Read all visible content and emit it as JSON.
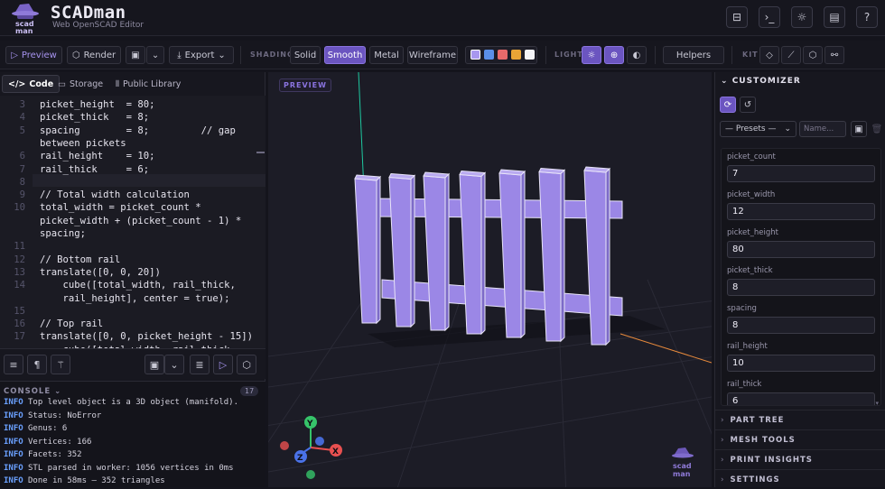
{
  "app": {
    "brand": "SCADman",
    "subtitle": "Web OpenSCAD Editor",
    "logo_text": "scad man"
  },
  "header_icons": [
    "panel-icon",
    "terminal-icon",
    "sun-icon",
    "book-icon",
    "help-icon"
  ],
  "toolbar": {
    "preview": "Preview",
    "render": "Render",
    "export": "Export",
    "shading_label": "SHADING",
    "shading": [
      "Solid",
      "Smooth",
      "Metal",
      "Wireframe"
    ],
    "shading_active": "Smooth",
    "swatches": [
      "#a897ee",
      "#5a8fe8",
      "#e86a6a",
      "#e8a436",
      "#f4f4f8"
    ],
    "light_label": "LIGHT",
    "helpers": "Helpers",
    "kit_label": "KIT"
  },
  "left_tabs": {
    "code": "Code",
    "storage": "Storage",
    "library": "Public Library"
  },
  "code_lines": [
    {
      "n": "3",
      "t": "picket_height  = 80;"
    },
    {
      "n": "4",
      "t": "picket_thick   = 8;"
    },
    {
      "n": "5",
      "t": "spacing        = 8;         // gap"
    },
    {
      "n": "",
      "t": "between pickets"
    },
    {
      "n": "6",
      "t": "rail_height    = 10;"
    },
    {
      "n": "7",
      "t": "rail_thick     = 6;"
    },
    {
      "n": "8",
      "t": ""
    },
    {
      "n": "9",
      "t": "// Total width calculation"
    },
    {
      "n": "10",
      "t": "total_width = picket_count *"
    },
    {
      "n": "",
      "t": "picket_width + (picket_count - 1) *"
    },
    {
      "n": "",
      "t": "spacing;"
    },
    {
      "n": "11",
      "t": ""
    },
    {
      "n": "12",
      "t": "// Bottom rail"
    },
    {
      "n": "13",
      "t": "translate([0, 0, 20])"
    },
    {
      "n": "14",
      "t": "    cube([total_width, rail_thick,"
    },
    {
      "n": "",
      "t": "    rail_height], center = true);"
    },
    {
      "n": "15",
      "t": ""
    },
    {
      "n": "16",
      "t": "// Top rail"
    },
    {
      "n": "17",
      "t": "translate([0, 0, picket_height - 15])"
    },
    {
      "n": "",
      "t": "    cube([total_width, rail_thick,"
    }
  ],
  "console": {
    "title": "CONSOLE",
    "count": "17",
    "lines": [
      {
        "level": "INFO",
        "msg": "Top level object is a 3D object (manifold)."
      },
      {
        "level": "INFO",
        "msg": "Status: NoError"
      },
      {
        "level": "INFO",
        "msg": "Genus: 6"
      },
      {
        "level": "INFO",
        "msg": "Vertices: 166"
      },
      {
        "level": "INFO",
        "msg": "Facets: 352"
      },
      {
        "level": "INFO",
        "msg": "STL parsed in worker: 1056 vertices in 0ms"
      },
      {
        "level": "INFO",
        "msg": "Done in 58ms — 352 triangles"
      }
    ]
  },
  "viewport": {
    "tag": "PREVIEW",
    "axes": {
      "x": "X",
      "y": "Y",
      "z": "Z"
    },
    "model_color": "#9b87e6"
  },
  "customizer": {
    "title": "CUSTOMIZER",
    "presets_placeholder": "— Presets —",
    "name_placeholder": "Name...",
    "params": [
      {
        "label": "picket_count",
        "value": "7"
      },
      {
        "label": "picket_width",
        "value": "12"
      },
      {
        "label": "picket_height",
        "value": "80"
      },
      {
        "label": "picket_thick",
        "value": "8"
      },
      {
        "label": "spacing",
        "value": "8"
      },
      {
        "label": "rail_height",
        "value": "10"
      },
      {
        "label": "rail_thick",
        "value": "6"
      }
    ],
    "sections": [
      "PART TREE",
      "MESH TOOLS",
      "PRINT INSIGHTS",
      "SETTINGS"
    ]
  }
}
